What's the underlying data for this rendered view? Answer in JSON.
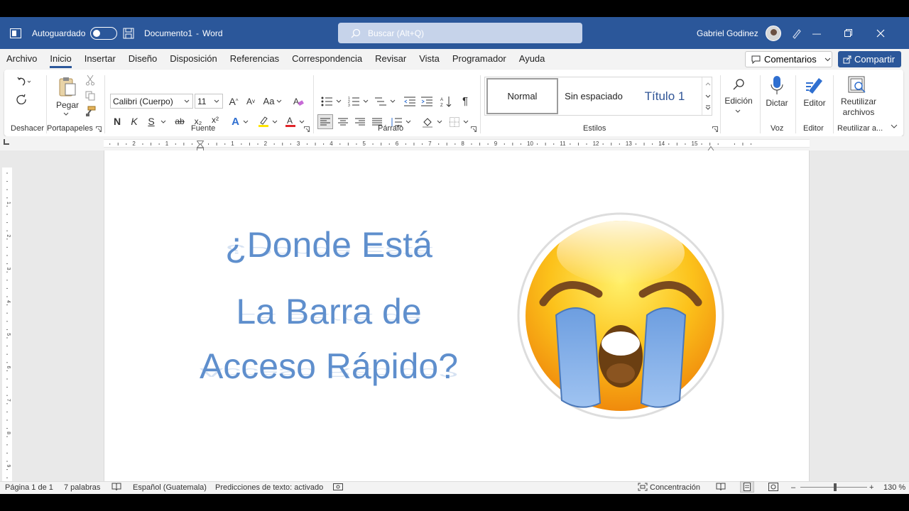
{
  "titlebar": {
    "autosave_label": "Autoguardado",
    "doc_title": "Documento1",
    "app_name": "Word",
    "title_sep": "-",
    "search_placeholder": "Buscar (Alt+Q)",
    "user_name": "Gabriel Godinez",
    "accent_color": "#2b579a"
  },
  "tabs": [
    "Archivo",
    "Inicio",
    "Insertar",
    "Diseño",
    "Disposición",
    "Referencias",
    "Correspondencia",
    "Revisar",
    "Vista",
    "Programador",
    "Ayuda"
  ],
  "active_tab": "Inicio",
  "actions": {
    "comments_label": "Comentarios",
    "share_label": "Compartir"
  },
  "ribbon": {
    "groups": {
      "undo": "Deshacer",
      "clipboard": "Portapapeles",
      "font": "Fuente",
      "paragraph": "Párrafo",
      "styles": "Estilos",
      "voice": "Voz",
      "editor": "Editor",
      "reuse": "Reutilizar a..."
    },
    "paste_label": "Pegar",
    "font_name": "Calibri (Cuerpo)",
    "font_size": "11",
    "case_label": "Aa",
    "bold": "N",
    "italic": "K",
    "underline": "S",
    "strike": "ab",
    "sub": "x₂",
    "sup": "x²",
    "style_normal": "Normal",
    "style_nospacing": "Sin espaciado",
    "style_title": "Título 1",
    "edit_label": "Edición",
    "dictate_label": "Dictar",
    "editor_label": "Editor",
    "reuse_label_1": "Reutilizar",
    "reuse_label_2": "archivos"
  },
  "document": {
    "line1": "¿Donde Está",
    "line2": "La Barra de",
    "line3": "Acceso Rápido?",
    "text_color": "#5f8fcd"
  },
  "status": {
    "page": "Página 1 de 1",
    "words": "7 palabras",
    "language": "Español (Guatemala)",
    "predictions": "Predicciones de texto: activado",
    "focus": "Concentración",
    "zoom": "130 %"
  },
  "ruler_numbers": [
    "2",
    "1",
    "1",
    "2",
    "3",
    "4",
    "5",
    "6",
    "7",
    "8",
    "9",
    "10",
    "11",
    "12",
    "13",
    "14",
    "15"
  ],
  "vruler_numbers": [
    "1",
    "2",
    "3",
    "4",
    "5",
    "6",
    "7",
    "8",
    "9"
  ]
}
